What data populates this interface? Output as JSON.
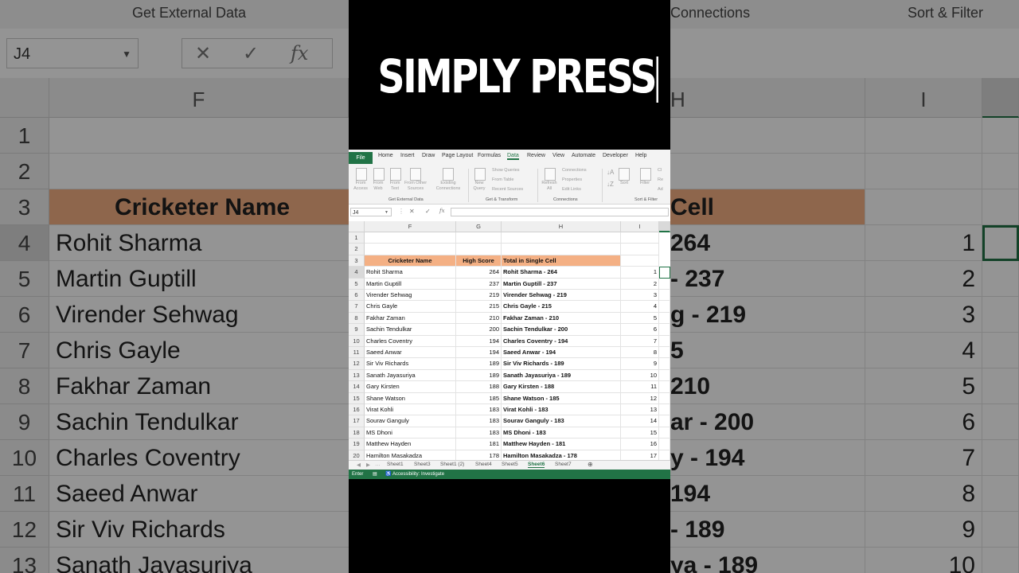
{
  "caption": "SIMPLY PRESS",
  "background": {
    "group_labels": {
      "get_external_data": "Get External Data",
      "connections": "Connections",
      "sort_filter": "Sort & Filter"
    },
    "name_box": "J4",
    "fx_cancel": "✕",
    "fx_enter": "✓",
    "fx_label": "fx",
    "col_f": "F",
    "col_h": "H",
    "col_i": "I",
    "rows": [
      "1",
      "2",
      "3",
      "4",
      "5",
      "6",
      "7",
      "8",
      "9",
      "10",
      "11",
      "12",
      "13"
    ],
    "names": [
      "",
      "",
      "Cricketer Name",
      "Rohit Sharma",
      "Martin Guptill",
      "Virender Sehwag",
      "Chris Gayle",
      "Fakhar Zaman",
      "Sachin Tendulkar",
      "Charles Coventry",
      "Saeed Anwar",
      "Sir Viv Richards",
      "Sanath Jayasuriya"
    ],
    "h_fragments": [
      "",
      "",
      "Cell",
      "264",
      "- 237",
      "g - 219",
      "5",
      "210",
      "ar - 200",
      "y - 194",
      "194",
      "- 189",
      "ya - 189"
    ],
    "i_values": [
      "",
      "",
      "",
      "1",
      "2",
      "3",
      "4",
      "5",
      "6",
      "7",
      "8",
      "9",
      "10"
    ]
  },
  "excel": {
    "file_tab": "File",
    "ribbon_tabs": [
      "Home",
      "Insert",
      "Draw",
      "Page Layout",
      "Formulas",
      "Data",
      "Review",
      "View",
      "Automate",
      "Developer",
      "Help"
    ],
    "active_tab": "Data",
    "ribbon_buttons": {
      "from_access": "From Access",
      "from_web": "From Web",
      "from_text": "From Text",
      "from_other": "From Other Sources",
      "existing": "Existing Connections",
      "new_query": "New Query",
      "show_queries": "Show Queries",
      "from_table": "From Table",
      "recent_sources": "Recent Sources",
      "refresh_all": "Refresh All",
      "connections": "Connections",
      "properties": "Properties",
      "edit_links": "Edit Links",
      "sort": "Sort",
      "filter": "Filter",
      "clear": "Cl",
      "reapply": "Re",
      "advanced": "Ad"
    },
    "group_labels": [
      "Get External Data",
      "Get & Transform",
      "Connections",
      "Sort & Filter"
    ],
    "name_box": "J4",
    "fx": "fx",
    "columns": [
      "F",
      "G",
      "H",
      "I"
    ],
    "header_row": {
      "name": "Cricketer Name",
      "score": "High Score",
      "total": "Total in Single Cell"
    },
    "rows": [
      {
        "r": "4",
        "name": "Rohit Sharma",
        "score": "264",
        "total": "Rohit Sharma - 264",
        "i": "1"
      },
      {
        "r": "5",
        "name": "Martin Guptill",
        "score": "237",
        "total": "Martin Guptill - 237",
        "i": "2"
      },
      {
        "r": "6",
        "name": "Virender Sehwag",
        "score": "219",
        "total": "Virender Sehwag - 219",
        "i": "3"
      },
      {
        "r": "7",
        "name": "Chris Gayle",
        "score": "215",
        "total": "Chris Gayle - 215",
        "i": "4"
      },
      {
        "r": "8",
        "name": "Fakhar Zaman",
        "score": "210",
        "total": "Fakhar Zaman - 210",
        "i": "5"
      },
      {
        "r": "9",
        "name": "Sachin Tendulkar",
        "score": "200",
        "total": "Sachin Tendulkar - 200",
        "i": "6"
      },
      {
        "r": "10",
        "name": "Charles Coventry",
        "score": "194",
        "total": "Charles Coventry - 194",
        "i": "7"
      },
      {
        "r": "11",
        "name": "Saeed Anwar",
        "score": "194",
        "total": "Saeed Anwar - 194",
        "i": "8"
      },
      {
        "r": "12",
        "name": "Sir Viv Richards",
        "score": "189",
        "total": "Sir Viv Richards - 189",
        "i": "9"
      },
      {
        "r": "13",
        "name": "Sanath Jayasuriya",
        "score": "189",
        "total": "Sanath Jayasuriya - 189",
        "i": "10"
      },
      {
        "r": "14",
        "name": "Gary Kirsten",
        "score": "188",
        "total": "Gary Kirsten - 188",
        "i": "11"
      },
      {
        "r": "15",
        "name": "Shane Watson",
        "score": "185",
        "total": "Shane Watson - 185",
        "i": "12"
      },
      {
        "r": "16",
        "name": "Virat Kohli",
        "score": "183",
        "total": "Virat Kohli - 183",
        "i": "13"
      },
      {
        "r": "17",
        "name": "Sourav Ganguly",
        "score": "183",
        "total": "Sourav Ganguly - 183",
        "i": "14"
      },
      {
        "r": "18",
        "name": "MS Dhoni",
        "score": "183",
        "total": "MS Dhoni - 183",
        "i": "15"
      },
      {
        "r": "19",
        "name": "Matthew Hayden",
        "score": "181",
        "total": "Matthew Hayden - 181",
        "i": "16"
      },
      {
        "r": "20",
        "name": "Hamilton Masakadza",
        "score": "178",
        "total": "Hamilton Masakadza - 178",
        "i": "17"
      }
    ],
    "sheet_tabs": [
      "Sheet1",
      "Sheet3",
      "Sheet1 (2)",
      "Sheet4",
      "Sheet5",
      "Sheet6",
      "Sheet7"
    ],
    "active_sheet": "Sheet6",
    "status_mode": "Enter",
    "accessibility": "Accessibility: Investigate"
  }
}
